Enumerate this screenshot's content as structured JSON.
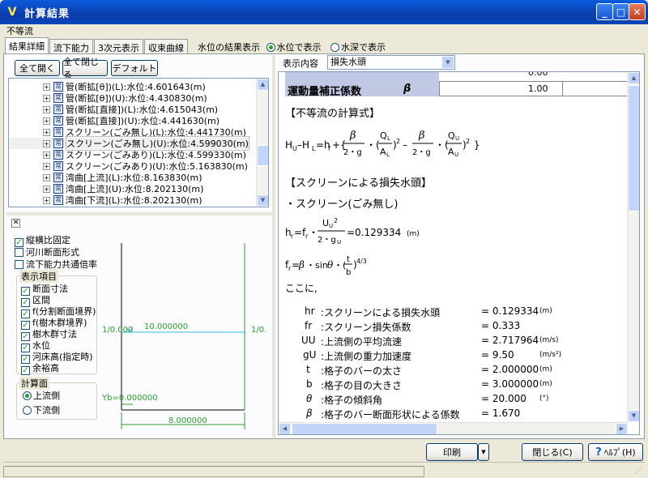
{
  "window": {
    "title": "計算結果"
  },
  "menu": {
    "item": "不等流"
  },
  "tabs": [
    {
      "label": "結果詳細"
    },
    {
      "label": "流下能力"
    },
    {
      "label": "3次元表示"
    },
    {
      "label": "収束曲線"
    }
  ],
  "water_level": {
    "label": "水位の結果表示",
    "opt1": "水位で表示",
    "opt2": "水深で表示"
  },
  "buttons": {
    "expand": "全て開く",
    "collapse": "全て閉じる",
    "default": "デフォルト",
    "print": "印刷",
    "close": "閉じる(C)",
    "help": "ﾍﾙﾌﾟ(H)"
  },
  "tree": [
    "管(断拡[θ])(L):水位:4.601643(m)",
    "管(断拡[θ])(U):水位:4.430830(m)",
    "管(断拡[直接])(L):水位:4.615043(m)",
    "管(断拡[直接])(U):水位:4.441630(m)",
    "スクリーン(ごみ無し)(L):水位:4.441730(m)",
    "スクリーン(ごみ無し)(U):水位:4.599030(m)",
    "スクリーン(ごみあり)(L):水位:4.599330(m)",
    "スクリーン(ごみあり)(U):水位:5.163830(m)",
    "湾曲[上流](L):水位:8.163830(m)",
    "湾曲[上流](U):水位:8.202130(m)",
    "湾曲[下流](L):水位:8.202130(m)"
  ],
  "options": {
    "fix_ratio": "縦横比固定",
    "river_section": "河川断面形式",
    "shared_flow": "流下能力共通倍率"
  },
  "display_items": {
    "title": "表示項目",
    "items": [
      "断面寸法",
      "区間",
      "f(分割断面境界)",
      "f(樹木群境界)",
      "樹木群寸法",
      "水位",
      "河床高(指定時)",
      "余裕高"
    ]
  },
  "calc_face": {
    "title": "計算面",
    "up": "上流側",
    "down": "下流側"
  },
  "diagram": {
    "slope_left": "1/0.000",
    "slope_right": "1/0.",
    "water_level": "10.000000",
    "yb": "Yb=0.000000",
    "width": "8.000000"
  },
  "content_select": {
    "label": "表示内容",
    "value": "損失水頭"
  },
  "content": {
    "row_value1": "0.00",
    "coef_label": "運動量補正係数",
    "coef_symbol": "β",
    "coef_value": "1.00",
    "h_formula": "【不等流の計算式】",
    "h_screen": "【スクリーンによる損失水頭】",
    "bullet": "・スクリーン(ごみ無し)",
    "result": "=0.129334",
    "unit_m": "(m)",
    "kokoni": "ここに,",
    "defs": [
      {
        "sym": "hr",
        "desc": ":スクリーンによる損失水頭",
        "val": "= 0.129334",
        "unit": "(m)"
      },
      {
        "sym": "fr",
        "desc": ":スクリーン損失係数",
        "val": "=     0.333",
        "unit": ""
      },
      {
        "sym": "UU",
        "desc": ":上流側の平均流速",
        "val": "= 2.717964",
        "unit": "(m/s)"
      },
      {
        "sym": "gU",
        "desc": ":上流側の重力加速度",
        "val": "=       9.50",
        "unit": "(m/s²)"
      },
      {
        "sym": "t",
        "desc": ":格子のバーの太さ",
        "val": "= 2.000000",
        "unit": "(m)"
      },
      {
        "sym": "b",
        "desc": ":格子の目の大きさ",
        "val": "= 3.000000",
        "unit": "(m)"
      },
      {
        "sym": "θ",
        "desc": ":格子の傾斜角",
        "val": "=     20.000",
        "unit": "(°)"
      },
      {
        "sym": "β",
        "desc": ":格子のバー断面形状による係数",
        "val": "=       1.670",
        "unit": ""
      }
    ]
  }
}
